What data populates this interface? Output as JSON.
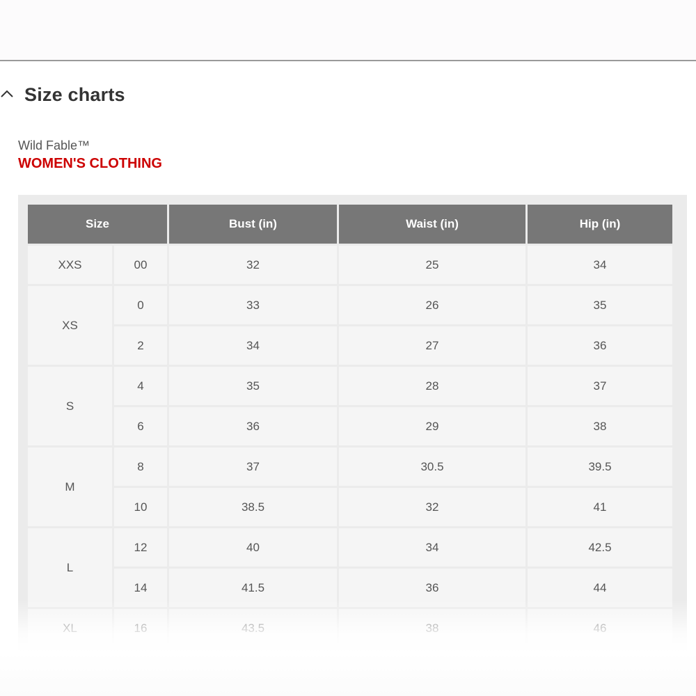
{
  "section": {
    "title": "Size charts",
    "chevron_icon": "chevron-up-icon"
  },
  "brand": "Wild Fable™",
  "category": "WOMEN'S CLOTHING",
  "colors": {
    "accent_red": "#cc0000",
    "header_bg": "#777777",
    "cell_bg": "#f5f5f5",
    "grid_bg": "#ebebeb"
  },
  "table": {
    "headers": {
      "size": "Size",
      "bust": "Bust (in)",
      "waist": "Waist (in)",
      "hip": "Hip (in)"
    },
    "groups": [
      {
        "size": "XXS",
        "rows": [
          {
            "num": "00",
            "bust": "32",
            "waist": "25",
            "hip": "34"
          }
        ]
      },
      {
        "size": "XS",
        "rows": [
          {
            "num": "0",
            "bust": "33",
            "waist": "26",
            "hip": "35"
          },
          {
            "num": "2",
            "bust": "34",
            "waist": "27",
            "hip": "36"
          }
        ]
      },
      {
        "size": "S",
        "rows": [
          {
            "num": "4",
            "bust": "35",
            "waist": "28",
            "hip": "37"
          },
          {
            "num": "6",
            "bust": "36",
            "waist": "29",
            "hip": "38"
          }
        ]
      },
      {
        "size": "M",
        "rows": [
          {
            "num": "8",
            "bust": "37",
            "waist": "30.5",
            "hip": "39.5"
          },
          {
            "num": "10",
            "bust": "38.5",
            "waist": "32",
            "hip": "41"
          }
        ]
      },
      {
        "size": "L",
        "rows": [
          {
            "num": "12",
            "bust": "40",
            "waist": "34",
            "hip": "42.5"
          },
          {
            "num": "14",
            "bust": "41.5",
            "waist": "36",
            "hip": "44"
          }
        ]
      },
      {
        "size": "XL",
        "rows": [
          {
            "num": "16",
            "bust": "43.5",
            "waist": "38",
            "hip": "46"
          }
        ]
      }
    ]
  }
}
